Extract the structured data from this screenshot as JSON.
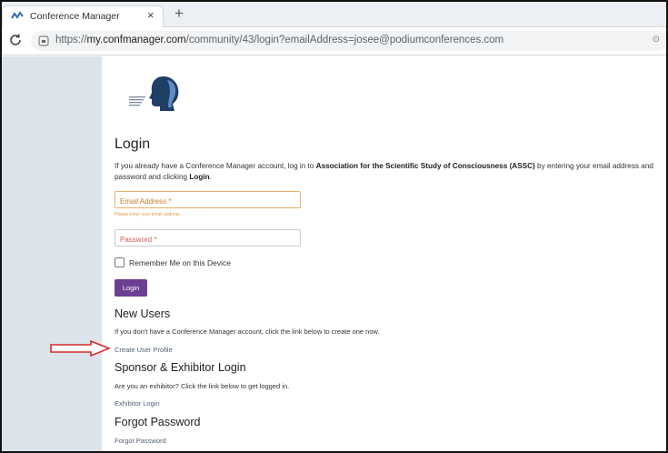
{
  "browser": {
    "tab_title": "Conference Manager",
    "tab_close": "×",
    "new_tab": "+",
    "url_prefix": "https://",
    "url_host": "my.confmanager.com",
    "url_path": "/community/43/login?emailAddress=josee@podiumconferences.com",
    "omnibox_right": "⊙"
  },
  "login": {
    "title": "Login",
    "intro_before": "If you already have a Conference Manager account, log in to ",
    "intro_org": "Association for the Scientific Study of Consciousness (ASSC)",
    "intro_middle": " by entering your email address and password and clicking ",
    "intro_action": "Login",
    "intro_end": ".",
    "email_placeholder": "Email Address *",
    "email_error": "Please enter your email address",
    "password_placeholder": "Password *",
    "remember_label": "Remember Me on this Device",
    "button_label": "Login"
  },
  "new_users": {
    "title": "New Users",
    "text": "If you don't have a Conference Manager account, click the link below to create one now.",
    "link": "Create User Profile"
  },
  "sponsor": {
    "title": "Sponsor & Exhibitor Login",
    "text": "Are you an exhibitor? Click the link below to get logged in.",
    "link": "Exhibitor Login"
  },
  "forgot": {
    "title": "Forgot Password",
    "link": "Forgot Password"
  },
  "colors": {
    "login_button": "#6c3f93",
    "annotation_arrow": "#d42a2a",
    "side_band": "#dde3ea"
  },
  "icons": {
    "favicon": "conference-manager-favicon",
    "reload": "reload-icon",
    "site_info": "site-info-icon",
    "logo": "assc-head-logo",
    "annotation": "red-arrow-annotation"
  }
}
